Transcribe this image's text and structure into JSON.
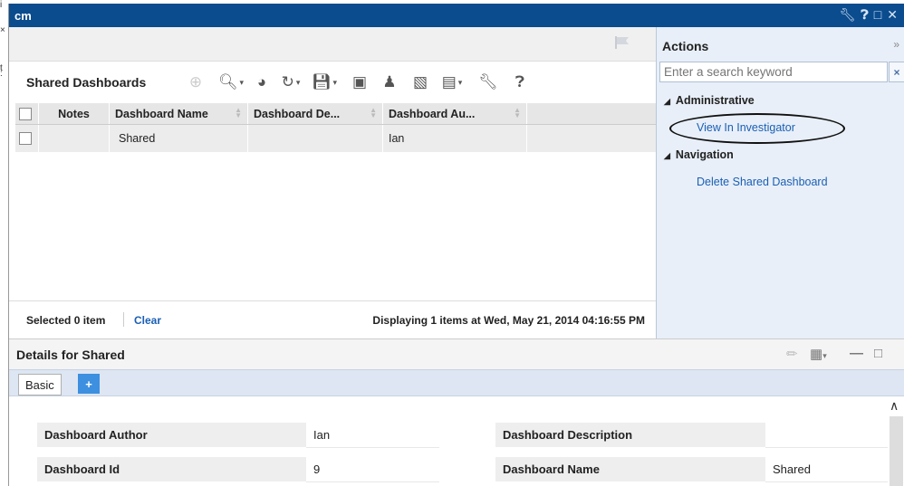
{
  "window": {
    "title": "cm",
    "controls": [
      "wrench-icon",
      "help-icon",
      "maximize-icon",
      "close-icon"
    ]
  },
  "left_gutter": [
    "i",
    "×",
    "t",
    ":"
  ],
  "shared_dashboards": {
    "title": "Shared Dashboards",
    "toolbar": [
      "add-icon",
      "search-icon",
      "pie-chart-icon",
      "refresh-icon",
      "save-icon",
      "view-icon",
      "person-icon",
      "export-icon",
      "import-icon",
      "wrench-icon",
      "help-icon"
    ],
    "columns": [
      "Notes",
      "Dashboard Name",
      "Dashboard De...",
      "Dashboard Au..."
    ],
    "rows": [
      {
        "notes": "",
        "name": "Shared",
        "description": "",
        "author": "Ian"
      }
    ],
    "footer": {
      "selected": "Selected 0 item",
      "clear": "Clear",
      "displaying": "Displaying 1 items at Wed, May 21, 2014 04:16:55 PM"
    }
  },
  "actions": {
    "title": "Actions",
    "search_placeholder": "Enter a search keyword",
    "search_clear": "×",
    "groups": [
      {
        "label": "Administrative",
        "items": [
          "View In Investigator"
        ]
      },
      {
        "label": "Navigation",
        "items": [
          "Delete Shared Dashboard"
        ]
      }
    ]
  },
  "details": {
    "title": "Details for Shared",
    "tabs": [
      "Basic"
    ],
    "add_tab": "+",
    "fields": [
      {
        "label": "Dashboard Author",
        "value": "Ian"
      },
      {
        "label": "Dashboard Id",
        "value": "9"
      },
      {
        "label": "Dashboard Description",
        "value": ""
      },
      {
        "label": "Dashboard Name",
        "value": "Shared"
      }
    ]
  },
  "colors": {
    "title_bar": "#0b4c8e",
    "link": "#1a5fb4",
    "actions_bg": "#e8eff8",
    "tab_plus": "#3d8fe0"
  }
}
